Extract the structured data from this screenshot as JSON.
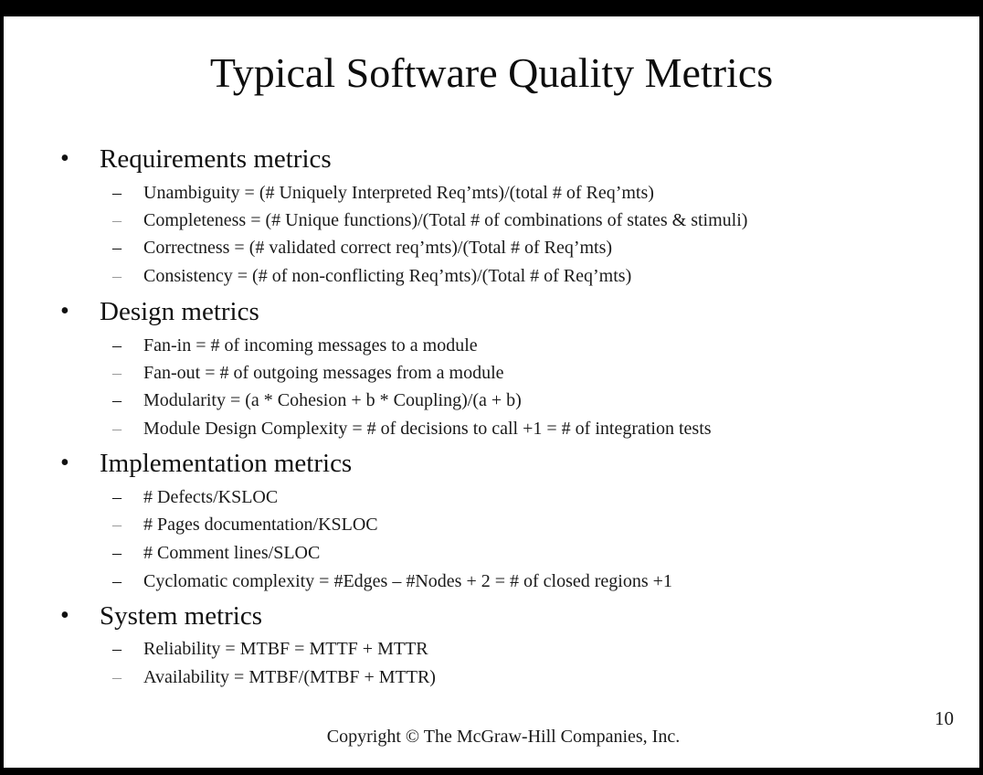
{
  "slide": {
    "title": "Typical Software Quality Metrics",
    "sections": [
      {
        "bullet": "•",
        "heading": "Requirements metrics",
        "items": [
          "Unambiguity = (# Uniquely Interpreted Req’mts)/(total # of Req’mts)",
          "Completeness = (# Unique functions)/(Total # of combinations of states & stimuli)",
          "Correctness = (# validated correct req’mts)/(Total # of Req’mts)",
          "Consistency = (# of non-conflicting Req’mts)/(Total # of Req’mts)"
        ]
      },
      {
        "bullet": "•",
        "heading": "Design metrics",
        "items": [
          "Fan-in = # of incoming messages to a module",
          "Fan-out = # of outgoing messages from a module",
          "Modularity = (a * Cohesion + b * Coupling)/(a + b)",
          "Module Design Complexity = # of decisions to call +1 = # of integration tests"
        ]
      },
      {
        "bullet": "•",
        "heading": "Implementation metrics",
        "items": [
          "# Defects/KSLOC",
          "# Pages documentation/KSLOC",
          "# Comment lines/SLOC",
          "Cyclomatic complexity = #Edges – #Nodes + 2 = # of closed regions +1"
        ]
      },
      {
        "bullet": "•",
        "heading": "System metrics",
        "items": [
          "Reliability = MTBF = MTTF + MTTR",
          "Availability = MTBF/(MTBF + MTTR)"
        ]
      }
    ],
    "dash": "–",
    "page_number": "10",
    "copyright": "Copyright © The McGraw-Hill Companies, Inc."
  }
}
